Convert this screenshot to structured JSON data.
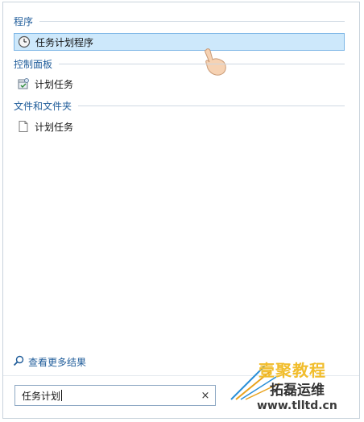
{
  "groups": [
    {
      "label": "程序",
      "items": [
        {
          "label": "任务计划程序",
          "icon": "clock-icon",
          "selected": true
        }
      ]
    },
    {
      "label": "控制面板",
      "items": [
        {
          "label": "计划任务",
          "icon": "scheduled-tasks-icon",
          "selected": false
        }
      ]
    },
    {
      "label": "文件和文件夹",
      "items": [
        {
          "label": "计划任务",
          "icon": "document-icon",
          "selected": false
        }
      ]
    }
  ],
  "more_results": {
    "label": "查看更多结果",
    "icon": "search-icon"
  },
  "search": {
    "value": "任务计划",
    "clear_icon": "×"
  },
  "watermark": {
    "line1": "壹聚教程",
    "line2": "拓磊运维",
    "url": "www.tlltd.cn"
  },
  "colors": {
    "accent": "#1f5c9a",
    "selection_bg": "#cde8fb",
    "selection_border": "#7db6e6",
    "watermark_gold": "#f1bd2c"
  }
}
